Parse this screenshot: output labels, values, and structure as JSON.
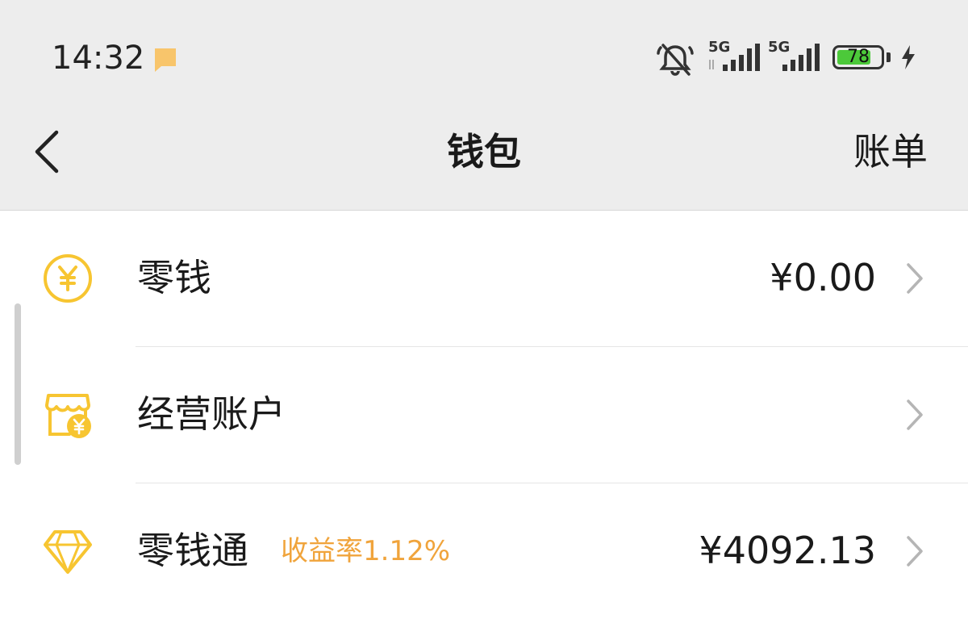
{
  "status_bar": {
    "time": "14:32",
    "network_1": "5G",
    "network_2": "5G",
    "battery_level": "78",
    "battery_percent": 78,
    "charging": true
  },
  "header": {
    "title": "钱包",
    "action": "账单"
  },
  "wallet_items": [
    {
      "label": "零钱",
      "amount": "¥0.00",
      "icon": "yen-coin-icon"
    },
    {
      "label": "经营账户",
      "amount": "",
      "icon": "store-yen-icon"
    },
    {
      "label": "零钱通",
      "badge": "收益率1.12%",
      "amount": "¥4092.13",
      "icon": "diamond-icon"
    }
  ],
  "colors": {
    "accent_yellow": "#f7c531",
    "rate_orange": "#f0a43c",
    "battery_green": "#4cc93a"
  }
}
